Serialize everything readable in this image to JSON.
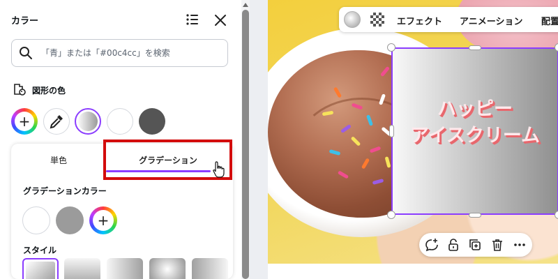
{
  "panel": {
    "title": "カラー",
    "search_placeholder": "「青」または「#00c4cc」を検索",
    "shape_color_label": "図形の色",
    "swatch_add_symbol": "+",
    "tabs": {
      "solid": "単色",
      "gradient": "グラデーション"
    },
    "gradient_colors_label": "グラデーションカラー",
    "gradient_add_symbol": "+",
    "style_label": "スタイル"
  },
  "canvas": {
    "text_line1": "ハッピー",
    "text_line2": "アイスクリーム"
  },
  "toolbar": {
    "effects_label": "エフェクト",
    "animation_label": "アニメーション",
    "position_label": "配置"
  },
  "colors": {
    "accent": "#8b3dff",
    "highlight": "#d30c0c",
    "dark_swatch": "#555555",
    "gray_swatch": "#9b9b9b"
  },
  "icons": [
    "search-icon",
    "list-icon",
    "close-icon",
    "shape-color-icon",
    "eyedropper-icon",
    "cursor-hand-icon",
    "transparency-icon",
    "comment-add-icon",
    "lock-icon",
    "duplicate-icon",
    "trash-icon",
    "more-icon"
  ]
}
